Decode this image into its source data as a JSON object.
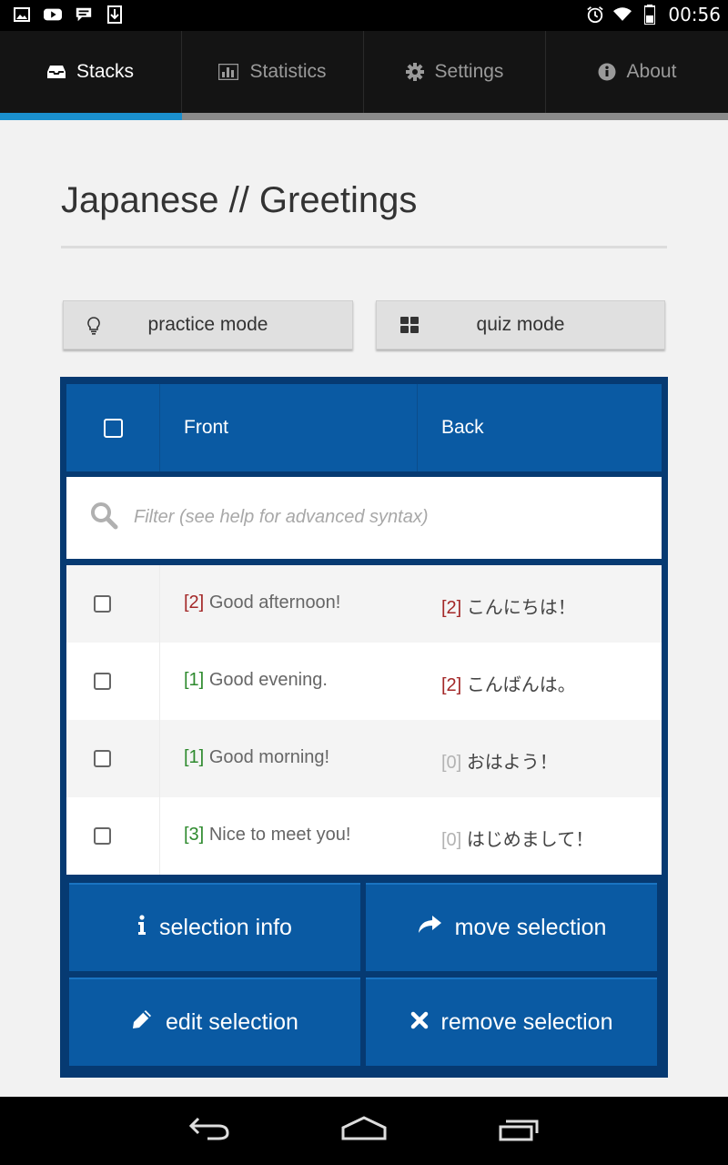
{
  "status_bar": {
    "time": "00:56",
    "icons_left": [
      "image-icon",
      "youtube-icon",
      "chat-icon",
      "download-icon"
    ],
    "icons_right": [
      "alarm-icon",
      "wifi-icon",
      "battery-icon"
    ]
  },
  "nav": {
    "tabs": [
      {
        "label": "Stacks",
        "icon": "inbox-icon",
        "active": true
      },
      {
        "label": "Statistics",
        "icon": "bar-chart-icon",
        "active": false
      },
      {
        "label": "Settings",
        "icon": "gear-icon",
        "active": false
      },
      {
        "label": "About",
        "icon": "info-circle-icon",
        "active": false
      }
    ]
  },
  "page": {
    "title": "Japanese // Greetings"
  },
  "modes": {
    "practice_label": "practice mode",
    "quiz_label": "quiz mode"
  },
  "table": {
    "header_front": "Front",
    "header_back": "Back",
    "filter_placeholder": "Filter (see help for advanced syntax)",
    "rows": [
      {
        "front_level": "[2]",
        "front_text": "Good afternoon!",
        "back_level": "[2]",
        "back_text": "こんにちは！"
      },
      {
        "front_level": "[1]",
        "front_text": "Good evening.",
        "back_level": "[2]",
        "back_text": "こんばんは。"
      },
      {
        "front_level": "[1]",
        "front_text": "Good morning!",
        "back_level": "[0]",
        "back_text": "おはよう！"
      },
      {
        "front_level": "[3]",
        "front_text": "Nice to meet you!",
        "back_level": "[0]",
        "back_text": "はじめまして！"
      }
    ]
  },
  "actions": {
    "selection_info": "selection info",
    "move_selection": "move selection",
    "edit_selection": "edit selection",
    "remove_selection": "remove selection"
  },
  "colors": {
    "accent": "#1a8fce",
    "table_header": "#0a5aa3",
    "card_border": "#063a72",
    "level_high": "#a32828",
    "level_low": "#2e8a2e",
    "level_zero": "#b3b3b3"
  }
}
